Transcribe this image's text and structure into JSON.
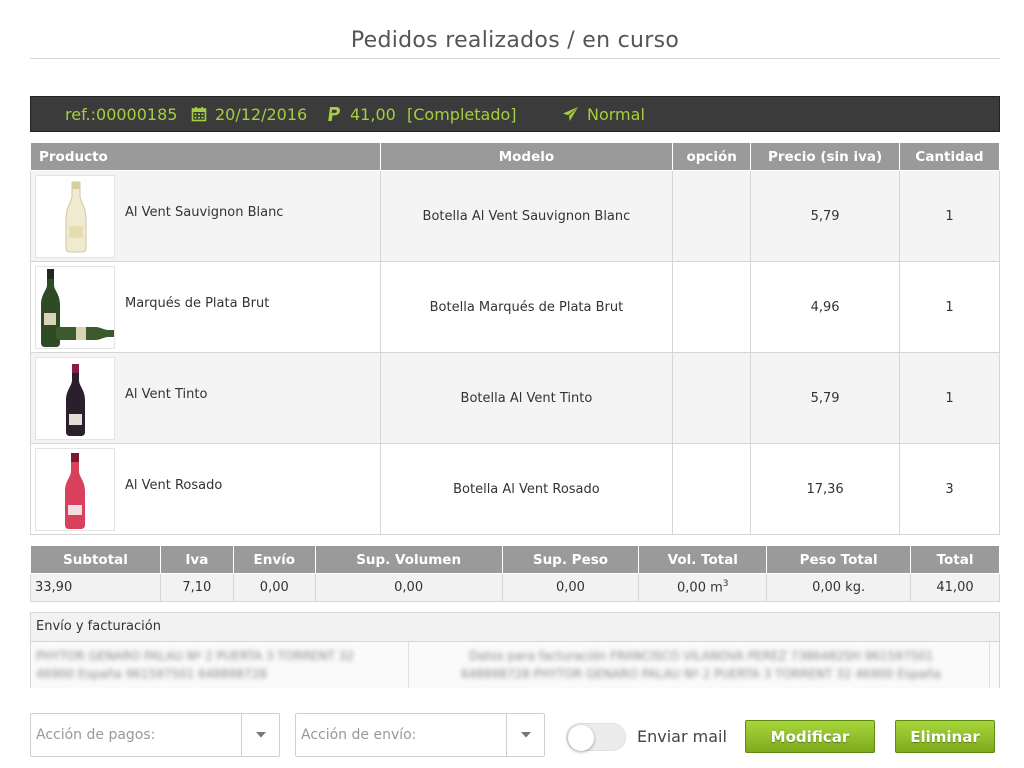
{
  "page": {
    "title": "Pedidos realizados / en curso"
  },
  "order": {
    "ref": "ref.:00000185",
    "date": "20/12/2016",
    "amount": "41,00",
    "status": "[Completado]",
    "shipping_type": "Normal",
    "accent_color": "#a4cf3e",
    "icons": [
      "calendar-icon",
      "paypal-icon",
      "paper-plane-icon"
    ]
  },
  "products": {
    "headers": [
      "Producto",
      "Modelo",
      "opción",
      "Precio (sin iva)",
      "Cantidad"
    ],
    "rows": [
      {
        "name": "Al Vent Sauvignon Blanc",
        "model": "Botella Al Vent Sauvignon Blanc",
        "option": "",
        "price": "5,79",
        "qty": "1"
      },
      {
        "name": "Marqués de Plata Brut",
        "model": "Botella Marqués de Plata Brut",
        "option": "",
        "price": "4,96",
        "qty": "1"
      },
      {
        "name": "Al Vent Tinto",
        "model": "Botella Al Vent Tinto",
        "option": "",
        "price": "5,79",
        "qty": "1"
      },
      {
        "name": "Al Vent Rosado",
        "model": "Botella Al Vent Rosado",
        "option": "",
        "price": "17,36",
        "qty": "3"
      }
    ]
  },
  "totals": {
    "headers": [
      "Subtotal",
      "Iva",
      "Envío",
      "Sup. Volumen",
      "Sup. Peso",
      "Vol. Total",
      "Peso Total",
      "Total"
    ],
    "subtotal": "33,90",
    "iva": "7,10",
    "envio": "0,00",
    "sup_volumen": "0,00",
    "sup_peso": "0,00",
    "vol_total": "0,00 m",
    "vol_unit_sup": "3",
    "peso_total": "0,00 kg.",
    "total": "41,00"
  },
  "shipping": {
    "title": "Envío y facturación",
    "left_line1": "PHYTOR GENARO PALAU Nº 2 PUERTA 3 TORRENT 32",
    "left_line2": "46900 España 961597501 648898728",
    "right_line1": "Datos para facturación FRANCISCO VILANOVA PEREZ 7386482SH 961597501",
    "right_line2": "648898728 PHYTOR GENARO PALAU Nº 2 PUERTA 3 TORRENT 32 46900 España"
  },
  "actions": {
    "payment_placeholder": "Acción de pagos:",
    "shipping_placeholder": "Acción de envío:",
    "send_mail_label": "Enviar mail",
    "send_mail_on": false,
    "modify_label": "Modificar",
    "delete_label": "Eliminar",
    "button_color": "#8fbf2a"
  }
}
